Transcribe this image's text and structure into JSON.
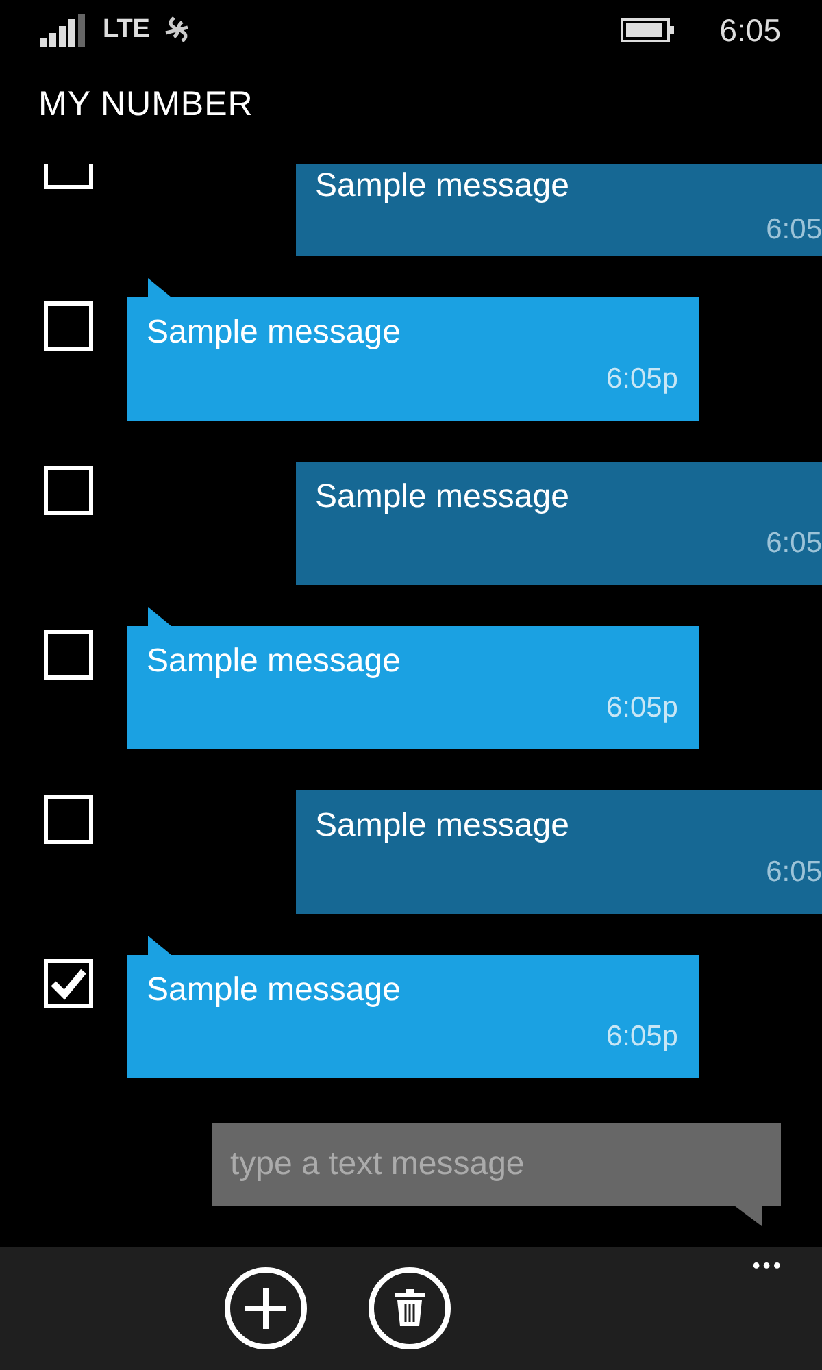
{
  "status_bar": {
    "network": "LTE",
    "time": "6:05"
  },
  "title": "MY NUMBER",
  "messages": [
    {
      "kind": "outgoing",
      "text": "Sample message",
      "time": "6:05",
      "checked": false
    },
    {
      "kind": "incoming",
      "text": "Sample message",
      "time": "6:05p",
      "checked": false
    },
    {
      "kind": "outgoing",
      "text": "Sample message",
      "time": "6:05",
      "checked": false
    },
    {
      "kind": "incoming",
      "text": "Sample message",
      "time": "6:05p",
      "checked": false
    },
    {
      "kind": "outgoing",
      "text": "Sample message",
      "time": "6:05",
      "checked": false
    },
    {
      "kind": "incoming",
      "text": "Sample message",
      "time": "6:05p",
      "checked": true
    }
  ],
  "compose": {
    "placeholder": "type a text message"
  },
  "app_bar": {
    "more": "•••"
  }
}
